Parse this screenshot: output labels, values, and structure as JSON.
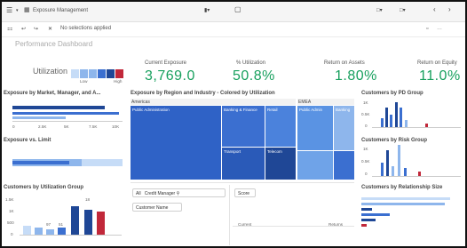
{
  "app": {
    "tab_label": "Exposure Management",
    "selections_label": "No selections applied",
    "sheet_title": "Performance Dashboard"
  },
  "utilization": {
    "label": "Utilization",
    "legend_low": "Low",
    "legend_high": "High"
  },
  "kpis": [
    {
      "label": "Current Exposure",
      "value": "3,769.0"
    },
    {
      "label": "% Utilization",
      "value": "50.8%"
    },
    {
      "label": "Return on Assets",
      "value": "1.80%"
    },
    {
      "label": "Return on Equity",
      "value": "11.0%"
    }
  ],
  "panels": {
    "exposure_market": "Exposure by Market, Manager, and A...",
    "exposure_region": "Exposure by Region and Industry - Colored by Utilization",
    "customers_pd": "Customers by PD Group",
    "exposure_limit": "Exposure vs. Limit",
    "customers_risk": "Customers by Risk Group",
    "customers_util": "Customers by Utilization Group",
    "customers_rel": "Customers by Relationship Size"
  },
  "treemap": {
    "region_a": "Americas",
    "region_b": "EMEA",
    "cell_a1": "Public Administration",
    "cell_a2": "Banking & Finance",
    "cell_a3": "Retail",
    "cell_a4": "Transport",
    "cell_a5": "Telecom",
    "cell_b1": "Public Admin",
    "cell_b2": "Banking"
  },
  "filters": {
    "dimension_1": "All",
    "dimension_2": "Credit Manager",
    "dimension_3": "Customer Name",
    "table_label": "Score",
    "col_current": "Current",
    "col_returns": "Returns"
  },
  "axis": {
    "market_ticks": [
      "0",
      "2.5K",
      "5K",
      "7.5K",
      "10K"
    ],
    "pd_ticks": [
      "1K",
      "0.5K",
      "0"
    ],
    "risk_ticks": [
      "1K",
      "0.5K",
      "0"
    ],
    "util_ticks": [
      "1.5K",
      "1K",
      "500",
      "0"
    ],
    "util_labels": [
      "97",
      "51",
      "18"
    ]
  },
  "colors": {
    "kpi_green": "#18a05e",
    "navy": "#1f4796",
    "blue": "#3b6fd0",
    "light_blue": "#8eb6ec",
    "pale_blue": "#c6dcf7",
    "red": "#c1283a"
  }
}
